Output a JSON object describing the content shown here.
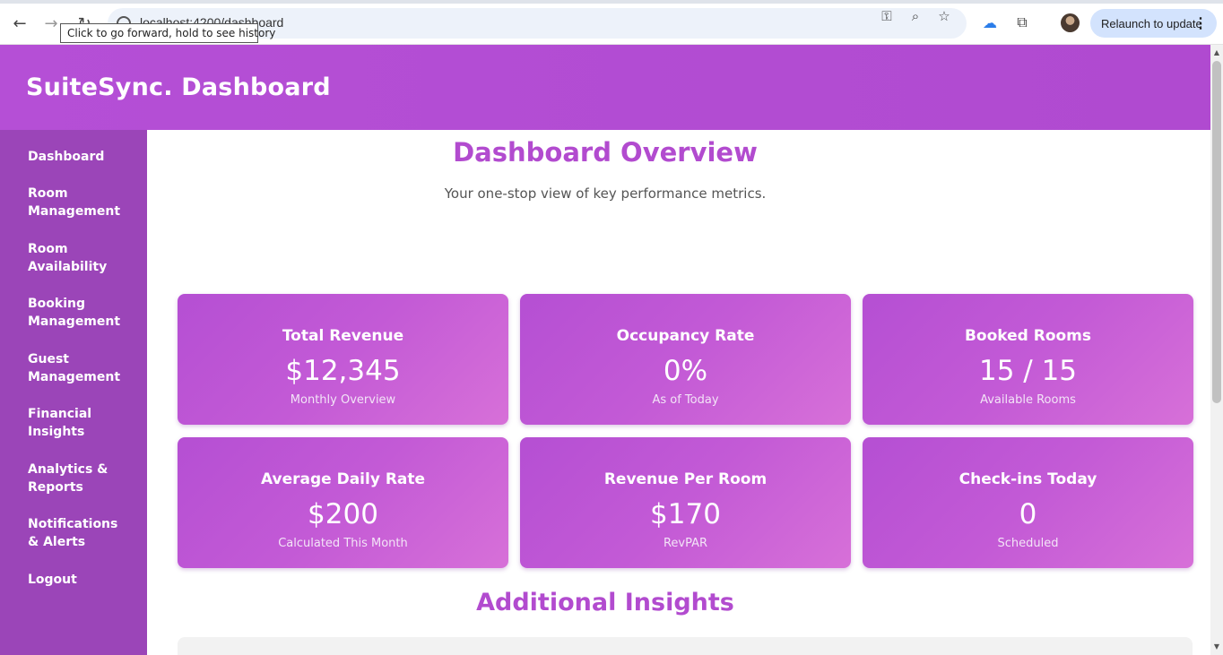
{
  "browser": {
    "url": "localhost:4200/dashboard",
    "url_shown": "localhost:4200/dashboard",
    "tooltip": "Click to go forward, hold to see history",
    "relaunch_label": "Relaunch to update",
    "icons": [
      "back-arrow-icon",
      "forward-arrow-icon",
      "reload-icon",
      "key-icon",
      "zoom-icon",
      "star-icon",
      "cloud-icon",
      "extensions-icon",
      "menu-dots-icon"
    ]
  },
  "app": {
    "brand": "SuiteSync. Dashboard"
  },
  "sidebar": {
    "items": [
      {
        "line1": "Dashboard",
        "line2": ""
      },
      {
        "line1": "Room",
        "line2": "Management"
      },
      {
        "line1": "Room",
        "line2": "Availability"
      },
      {
        "line1": "Booking",
        "line2": "Management"
      },
      {
        "line1": "Guest",
        "line2": "Management"
      },
      {
        "line1": "Financial",
        "line2": "Insights"
      },
      {
        "line1": "Analytics &",
        "line2": "Reports"
      },
      {
        "line1": "Notifications",
        "line2": "& Alerts"
      },
      {
        "line1": "Logout",
        "line2": ""
      }
    ]
  },
  "main": {
    "title": "Dashboard Overview",
    "subtitle": "Your one-stop view of key performance metrics.",
    "cards": [
      {
        "title": "Total Revenue",
        "value": "$12,345",
        "note": "Monthly Overview"
      },
      {
        "title": "Occupancy Rate",
        "value": "0%",
        "note": "As of Today"
      },
      {
        "title": "Booked Rooms",
        "value": "15 / 15",
        "note": "Available Rooms"
      },
      {
        "title": "Average Daily Rate",
        "value": "$200",
        "note": "Calculated This Month"
      },
      {
        "title": "Revenue Per Room",
        "value": "$170",
        "note": "RevPAR"
      },
      {
        "title": "Check-ins Today",
        "value": "0",
        "note": "Scheduled"
      }
    ],
    "insights_title": "Additional Insights"
  },
  "colors": {
    "header": "#b54fd6",
    "sidebar": "#9b45b8",
    "accent": "#b24bcf",
    "card_start": "#b54fd3",
    "card_end": "#d770d8"
  }
}
